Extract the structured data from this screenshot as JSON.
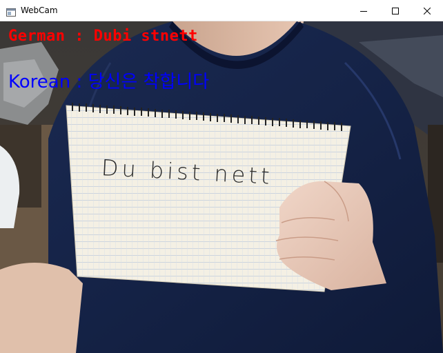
{
  "window": {
    "title": "WebCam",
    "icons": {
      "app": "window-app-icon",
      "minimize": "minimize-icon",
      "maximize": "maximize-icon",
      "close": "close-icon"
    }
  },
  "overlay": {
    "german": "German : Dubi stnett",
    "korean": "Korean : 당신은 착합니다",
    "german_color": "#ff0000",
    "korean_color": "#0000ff"
  },
  "scene": {
    "notebook_text": "Du bist nett",
    "shirt_color": "#152347"
  }
}
